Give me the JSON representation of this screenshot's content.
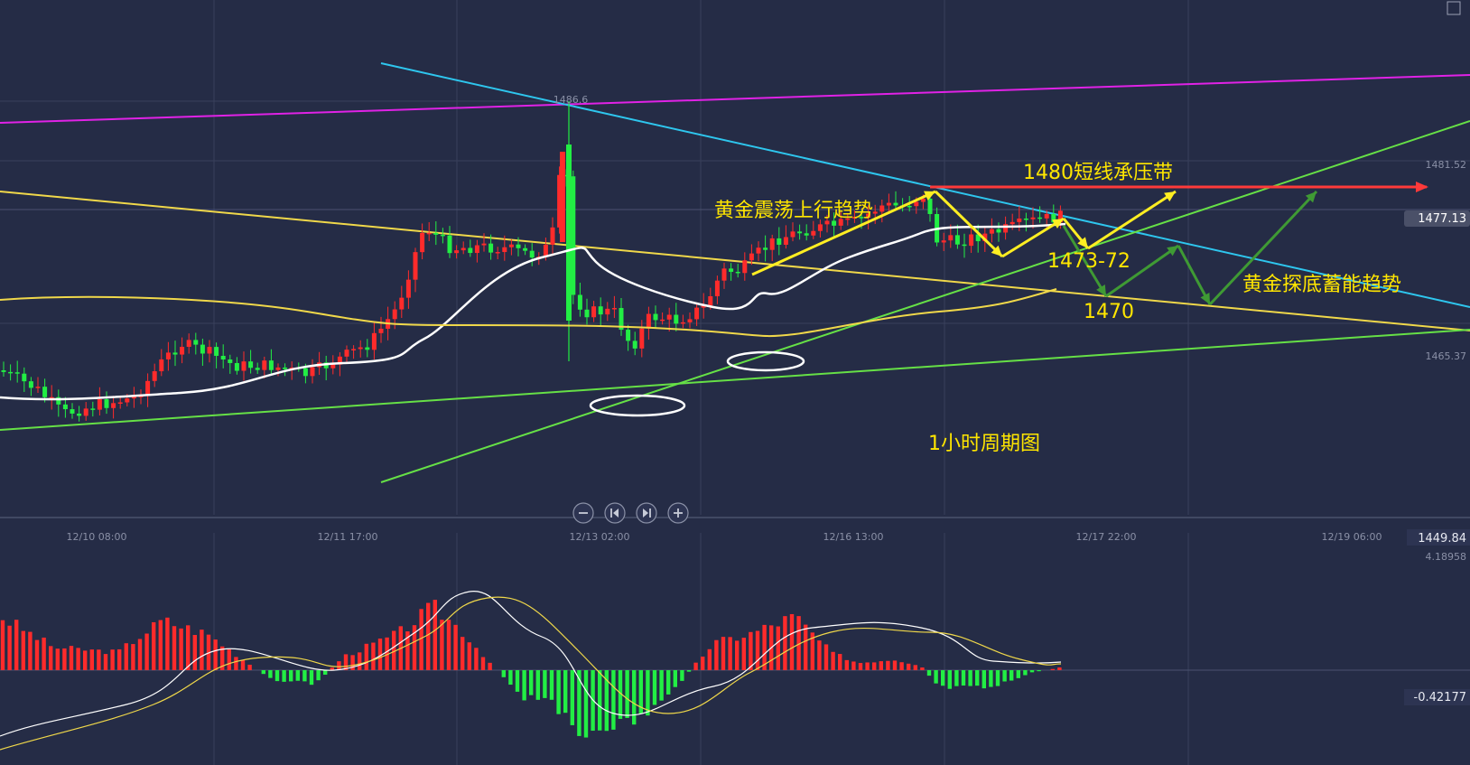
{
  "chart_data": {
    "type": "candlestick",
    "timeframe_label": "1小时周期图",
    "x_labels": [
      "12/10 08:00",
      "12/11 17:00",
      "12/13 02:00",
      "12/16 13:00",
      "12/17 22:00",
      "12/19 06:00"
    ],
    "price_labels": [
      "1481.52",
      "1465.37",
      "1449.84"
    ],
    "current_price": "1477.13",
    "high_label": "1486.6",
    "macd_labels": {
      "top": "4.18958",
      "zero": "-0.42177"
    },
    "annotations": [
      {
        "id": "resist",
        "text": "1480短线承压带"
      },
      {
        "id": "uptrend",
        "text": "黄金震荡上行趋势"
      },
      {
        "id": "l1473",
        "text": "1473-72"
      },
      {
        "id": "l1470",
        "text": "1470"
      },
      {
        "id": "bottom",
        "text": "黄金探底蓄能趋势"
      }
    ],
    "colors": {
      "background": "#252c46",
      "up": "#ff2b2b",
      "down": "#22ee44",
      "ma_white": "#ffffff",
      "ma_yellow": "#f0d84a",
      "trend_cyan": "#2ec6ee",
      "trend_magenta": "#e022e6",
      "trend_green": "#66e046",
      "resistance_red": "#ff3a3a",
      "arrow_yellow": "#ffee22",
      "arrow_green": "#3f9a34",
      "annotation": "#ffe600"
    }
  }
}
